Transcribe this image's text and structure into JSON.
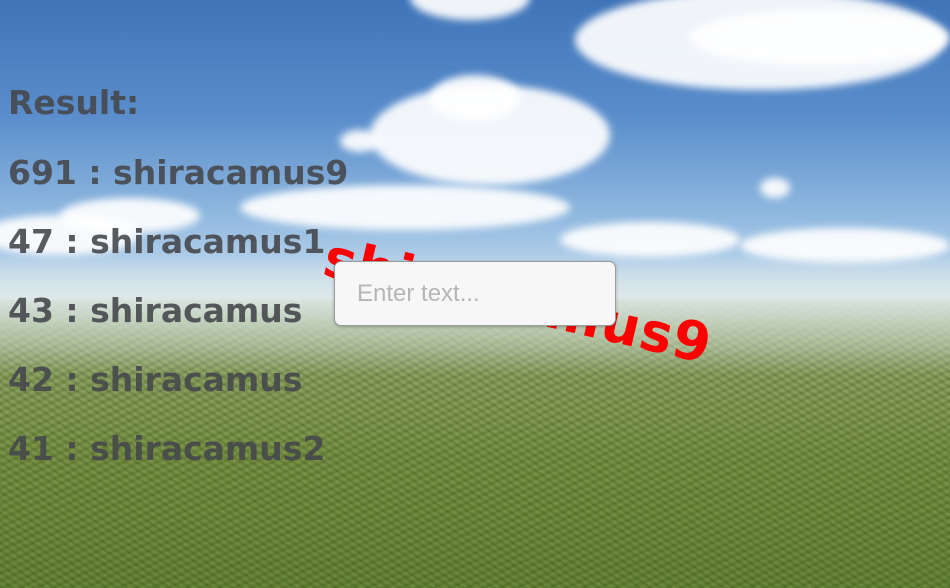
{
  "hud": {
    "result_label": "Result:",
    "results": [
      "691 : shiracamus9",
      "47 : shiracamus1",
      "43 : shiracamus",
      "42 : shiracamus",
      "41 : shiracamus2"
    ]
  },
  "world_label": {
    "text": "shiracamus9",
    "color": "#ff0000"
  },
  "text_input": {
    "value": "",
    "placeholder": "Enter text..."
  },
  "colors": {
    "hud_text": "#46484c",
    "input_background": "#f7f7f7"
  }
}
